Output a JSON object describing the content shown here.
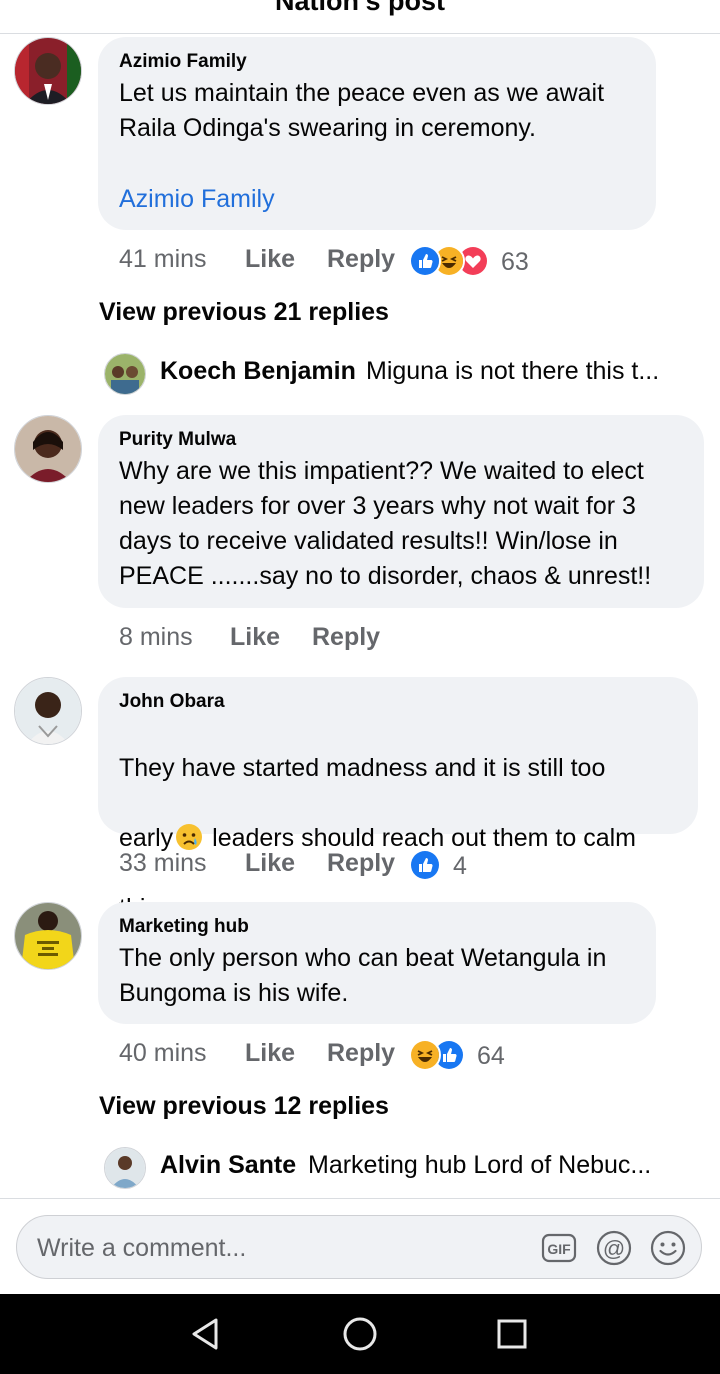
{
  "header": {
    "title": "Nation's post"
  },
  "comments": [
    {
      "author": "Azimio Family",
      "text": "Let us maintain the peace even as we await\nRaila Odinga's swearing in ceremony.",
      "tag": "Azimio Family",
      "time": "41 mins",
      "like_label": "Like",
      "reply_label": "Reply",
      "reaction_count": "63",
      "reactions": [
        "like-icon",
        "haha-icon",
        "love-icon"
      ]
    },
    {
      "author": "Purity Mulwa",
      "text": "Why are we this impatient??  We waited to elect\nnew leaders for over 3 years why not wait for 3\ndays to receive validated results!! Win/lose in\nPEACE .......say no to disorder, chaos & unrest!!",
      "time": "8 mins",
      "like_label": "Like",
      "reply_label": "Reply"
    },
    {
      "author": "John Obara",
      "text_line1": "They have started madness and it is still too",
      "text_line2a": "early",
      "text_line2b": " leaders should reach out them to calm",
      "text_line3": "things.",
      "emoji": "crying-face-icon",
      "time": "33 mins",
      "like_label": "Like",
      "reply_label": "Reply",
      "reaction_count": "4",
      "reactions": [
        "like-icon"
      ]
    },
    {
      "author": "Marketing hub",
      "text": "The only person who can beat Wetangula in\nBungoma is his wife.",
      "time": "40 mins",
      "like_label": "Like",
      "reply_label": "Reply",
      "reaction_count": "64",
      "reactions": [
        "haha-icon",
        "like-icon"
      ]
    }
  ],
  "threads": [
    {
      "view_previous": "View previous 21 replies",
      "reply_name": "Koech Benjamin",
      "reply_text": "Miguna is not there this t..."
    },
    {
      "view_previous": "View previous 12 replies",
      "reply_name": "Alvin Sante",
      "reply_text": "Marketing hub Lord of Nebuc..."
    }
  ],
  "composer": {
    "placeholder": "Write a comment...",
    "gif_label": "GIF",
    "mention_label": "@"
  },
  "colors": {
    "bubble": "#f0f2f5",
    "link": "#216fdb",
    "like_blue": "#1877f2",
    "love_red": "#f33e58",
    "haha_yellow": "#f7b125",
    "meta_gray": "#65676b"
  },
  "system_nav": [
    "back-icon",
    "home-icon",
    "recents-icon"
  ]
}
